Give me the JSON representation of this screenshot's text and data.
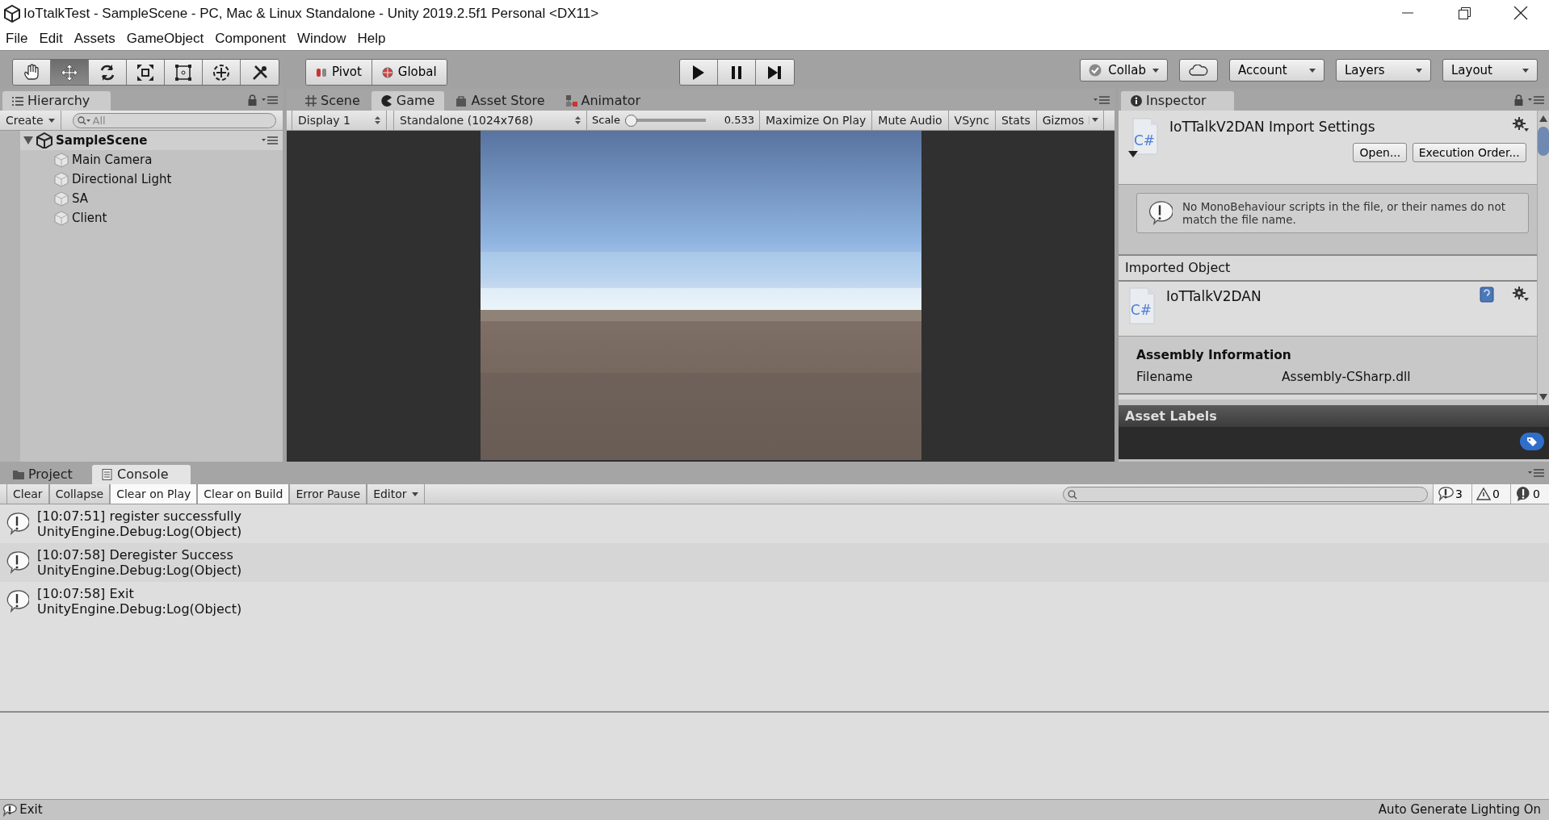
{
  "window": {
    "title": "IoTtalkTest - SampleScene - PC, Mac & Linux Standalone - Unity 2019.2.5f1 Personal <DX11>"
  },
  "menu": [
    "File",
    "Edit",
    "Assets",
    "GameObject",
    "Component",
    "Window",
    "Help"
  ],
  "toolbar": {
    "tools": [
      {
        "kind": "hand",
        "selected": false
      },
      {
        "kind": "move",
        "selected": true
      },
      {
        "kind": "rotate",
        "selected": false
      },
      {
        "kind": "scale",
        "selected": false
      },
      {
        "kind": "rect",
        "selected": false
      },
      {
        "kind": "transform",
        "selected": false
      },
      {
        "kind": "custom",
        "selected": false
      }
    ],
    "handle_toggles": [
      {
        "kind": "pivot",
        "label": "Pivot"
      },
      {
        "kind": "global",
        "label": "Global"
      }
    ],
    "playback": [
      {
        "kind": "play"
      },
      {
        "kind": "pause"
      },
      {
        "kind": "step"
      }
    ],
    "collab": "Collab",
    "dropdowns": [
      "Account",
      "Layers",
      "Layout"
    ]
  },
  "hierarchy": {
    "tab": "Hierarchy",
    "create": "Create",
    "search": {
      "placeholder": "All"
    },
    "scene": {
      "name": "SampleScene",
      "expanded": true,
      "children": [
        {
          "name": "Main Camera"
        },
        {
          "name": "Directional Light"
        },
        {
          "name": "SA"
        },
        {
          "name": "Client"
        }
      ]
    }
  },
  "view_tabs": [
    {
      "kind": "scene",
      "label": "Scene",
      "selected": false
    },
    {
      "kind": "game",
      "label": "Game",
      "selected": true
    },
    {
      "kind": "store",
      "label": "Asset Store",
      "selected": false
    },
    {
      "kind": "animator",
      "label": "Animator",
      "selected": false
    }
  ],
  "game_toolbar": {
    "display": "Display 1",
    "resolution": "Standalone (1024x768)",
    "scale_label": "Scale",
    "scale": {
      "level": 0.0
    },
    "scale_value": "0.533",
    "toggles": [
      {
        "label": "Maximize On Play",
        "on": false
      },
      {
        "label": "Mute Audio",
        "on": false
      },
      {
        "label": "VSync",
        "on": false
      },
      {
        "label": "Stats",
        "on": false
      },
      {
        "label": "Gizmos",
        "on": false
      }
    ]
  },
  "inspector": {
    "tab": "Inspector",
    "title": "IoTTalkV2DAN Import Settings",
    "icon_label": "C#",
    "buttons": [
      "Open...",
      "Execution Order..."
    ],
    "warning": "No MonoBehaviour scripts in the file, or their names do not match the file name.",
    "imported_heading": "Imported Object",
    "object_name": "IoTTalkV2DAN",
    "object_icon_label": "C#",
    "assembly_heading": "Assembly Information",
    "fields": [
      {
        "label": "Filename",
        "value": "Assembly-CSharp.dll"
      }
    ],
    "labels_heading": "Asset Labels"
  },
  "bottom_tabs": [
    {
      "kind": "project",
      "label": "Project",
      "selected": false
    },
    {
      "kind": "console",
      "label": "Console",
      "selected": true
    }
  ],
  "console": {
    "buttons": [
      {
        "kind": "toggle",
        "label": "Clear",
        "on": false
      },
      {
        "kind": "toggle",
        "label": "Collapse",
        "on": false
      },
      {
        "kind": "toggle",
        "label": "Clear on Play",
        "on": true
      },
      {
        "kind": "toggle",
        "label": "Clear on Build",
        "on": true
      },
      {
        "kind": "toggle",
        "label": "Error Pause",
        "on": false
      },
      {
        "kind": "dropdown",
        "label": "Editor",
        "on": false
      }
    ],
    "counts": [
      {
        "kind": "info",
        "count": "3"
      },
      {
        "kind": "warning",
        "count": "0"
      },
      {
        "kind": "error",
        "count": "0"
      }
    ],
    "entries": [
      {
        "message": "[10:07:51] register successfully",
        "trace": "UnityEngine.Debug:Log(Object)"
      },
      {
        "message": "[10:07:58] Deregister Success",
        "trace": "UnityEngine.Debug:Log(Object)"
      },
      {
        "message": "[10:07:58] Exit",
        "trace": "UnityEngine.Debug:Log(Object)"
      }
    ]
  },
  "status_bar": {
    "message": "Exit",
    "right": "Auto Generate Lighting On"
  }
}
